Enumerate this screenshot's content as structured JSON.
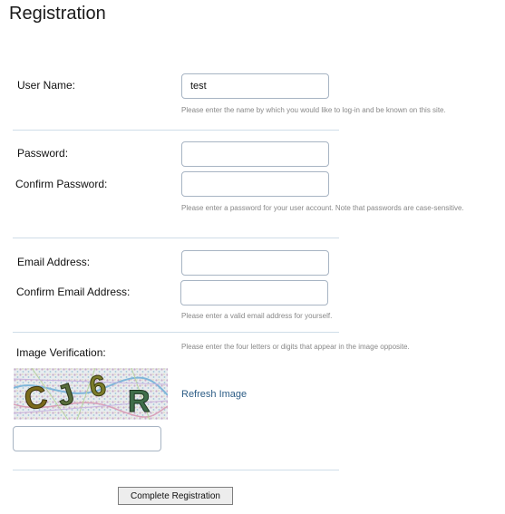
{
  "page": {
    "title": "Registration"
  },
  "form": {
    "username": {
      "label": "User Name:",
      "value": "test",
      "hint": "Please enter the name by which you would like to log-in and be known on this site."
    },
    "password": {
      "label": "Password:",
      "value": ""
    },
    "confirm_password": {
      "label": "Confirm Password:",
      "value": "",
      "hint": "Please enter a password for your user account. Note that passwords are case-sensitive."
    },
    "email": {
      "label": "Email Address:",
      "value": ""
    },
    "confirm_email": {
      "label": "Confirm Email Address:",
      "value": "",
      "hint": "Please enter a valid email address for yourself."
    },
    "verification": {
      "label": "Image Verification:",
      "hint": "Please enter the four letters or digits that appear in the image opposite.",
      "captcha_text": "CJ6R",
      "refresh_label": "Refresh Image",
      "value": ""
    },
    "submit_label": "Complete Registration"
  }
}
